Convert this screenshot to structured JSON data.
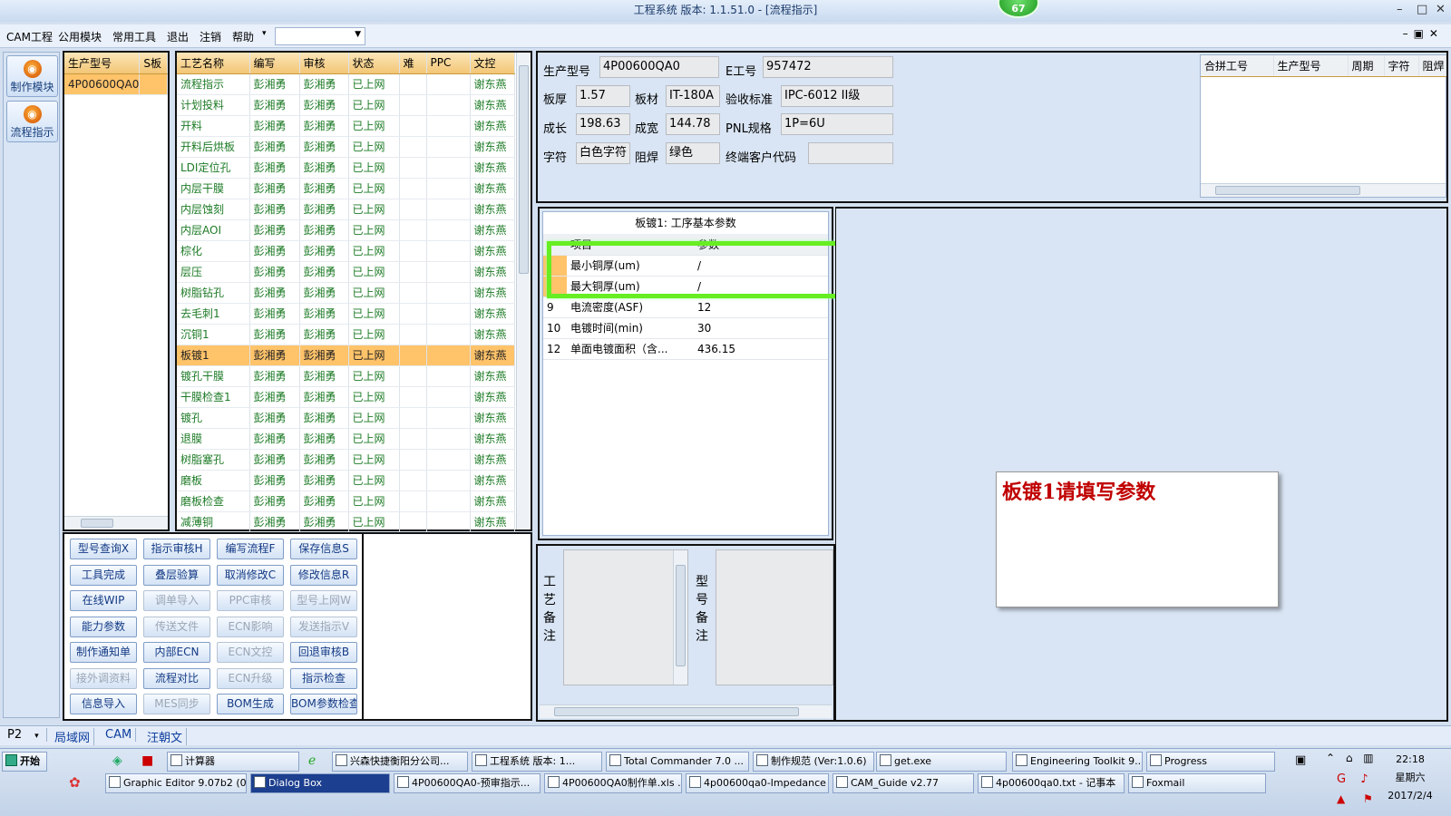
{
  "window": {
    "title": "工程系统   版本: 1.1.51.0 - [流程指示]",
    "badge": "67"
  },
  "menu": [
    "CAM工程",
    "公用模块",
    "常用工具",
    "退出",
    "注销",
    "帮助"
  ],
  "sidebar": [
    {
      "label": "制作模块"
    },
    {
      "label": "流程指示"
    }
  ],
  "models_panel": {
    "columns": [
      "生产型号",
      "S板"
    ],
    "rows": [
      [
        "4P00600QA0",
        ""
      ]
    ]
  },
  "process_table": {
    "columns": [
      "工艺名称",
      "编写",
      "审核",
      "状态",
      "难",
      "PPC",
      "文控"
    ],
    "rows": [
      [
        "流程指示",
        "彭湘勇",
        "彭湘勇",
        "已上网",
        "",
        "",
        "谢东燕"
      ],
      [
        "计划投料",
        "彭湘勇",
        "彭湘勇",
        "已上网",
        "",
        "",
        "谢东燕"
      ],
      [
        "开料",
        "彭湘勇",
        "彭湘勇",
        "已上网",
        "",
        "",
        "谢东燕"
      ],
      [
        "开料后烘板",
        "彭湘勇",
        "彭湘勇",
        "已上网",
        "",
        "",
        "谢东燕"
      ],
      [
        "LDI定位孔",
        "彭湘勇",
        "彭湘勇",
        "已上网",
        "",
        "",
        "谢东燕"
      ],
      [
        "内层干膜",
        "彭湘勇",
        "彭湘勇",
        "已上网",
        "",
        "",
        "谢东燕"
      ],
      [
        "内层蚀刻",
        "彭湘勇",
        "彭湘勇",
        "已上网",
        "",
        "",
        "谢东燕"
      ],
      [
        "内层AOI",
        "彭湘勇",
        "彭湘勇",
        "已上网",
        "",
        "",
        "谢东燕"
      ],
      [
        "棕化",
        "彭湘勇",
        "彭湘勇",
        "已上网",
        "",
        "",
        "谢东燕"
      ],
      [
        "层压",
        "彭湘勇",
        "彭湘勇",
        "已上网",
        "",
        "",
        "谢东燕"
      ],
      [
        "树脂钻孔",
        "彭湘勇",
        "彭湘勇",
        "已上网",
        "",
        "",
        "谢东燕"
      ],
      [
        "去毛刺1",
        "彭湘勇",
        "彭湘勇",
        "已上网",
        "",
        "",
        "谢东燕"
      ],
      [
        "沉铜1",
        "彭湘勇",
        "彭湘勇",
        "已上网",
        "",
        "",
        "谢东燕"
      ],
      [
        "板镀1",
        "彭湘勇",
        "彭湘勇",
        "已上网",
        "",
        "",
        "谢东燕"
      ],
      [
        "镀孔干膜",
        "彭湘勇",
        "彭湘勇",
        "已上网",
        "",
        "",
        "谢东燕"
      ],
      [
        "干膜检查1",
        "彭湘勇",
        "彭湘勇",
        "已上网",
        "",
        "",
        "谢东燕"
      ],
      [
        "镀孔",
        "彭湘勇",
        "彭湘勇",
        "已上网",
        "",
        "",
        "谢东燕"
      ],
      [
        "退膜",
        "彭湘勇",
        "彭湘勇",
        "已上网",
        "",
        "",
        "谢东燕"
      ],
      [
        "树脂塞孔",
        "彭湘勇",
        "彭湘勇",
        "已上网",
        "",
        "",
        "谢东燕"
      ],
      [
        "磨板",
        "彭湘勇",
        "彭湘勇",
        "已上网",
        "",
        "",
        "谢东燕"
      ],
      [
        "磨板检查",
        "彭湘勇",
        "彭湘勇",
        "已上网",
        "",
        "",
        "谢东燕"
      ],
      [
        "减薄铜",
        "彭湘勇",
        "彭湘勇",
        "已上网",
        "",
        "",
        "谢东燕"
      ]
    ],
    "selected_index": 13
  },
  "buttons": [
    {
      "label": "型号查询X",
      "enabled": true
    },
    {
      "label": "指示审核H",
      "enabled": true
    },
    {
      "label": "编写流程F",
      "enabled": true
    },
    {
      "label": "保存信息S",
      "enabled": true
    },
    {
      "label": "工具完成",
      "enabled": true
    },
    {
      "label": "叠层验算",
      "enabled": true
    },
    {
      "label": "取消修改C",
      "enabled": true
    },
    {
      "label": "修改信息R",
      "enabled": true
    },
    {
      "label": "在线WIP",
      "enabled": true
    },
    {
      "label": "调单导入",
      "enabled": false
    },
    {
      "label": "PPC审核",
      "enabled": false
    },
    {
      "label": "型号上网W",
      "enabled": false
    },
    {
      "label": "能力参数",
      "enabled": true
    },
    {
      "label": "传送文件",
      "enabled": false
    },
    {
      "label": "ECN影响",
      "enabled": false
    },
    {
      "label": "发送指示V",
      "enabled": false
    },
    {
      "label": "制作通知单",
      "enabled": true
    },
    {
      "label": "内部ECN",
      "enabled": true
    },
    {
      "label": "ECN文控",
      "enabled": false
    },
    {
      "label": "回退审核B",
      "enabled": true
    },
    {
      "label": "接外调资料",
      "enabled": false
    },
    {
      "label": "流程对比",
      "enabled": true
    },
    {
      "label": "ECN升级",
      "enabled": false
    },
    {
      "label": "指示检查",
      "enabled": true
    },
    {
      "label": "信息导入",
      "enabled": true
    },
    {
      "label": "MES同步",
      "enabled": false
    },
    {
      "label": "BOM生成",
      "enabled": true
    },
    {
      "label": "BOM参数检查",
      "enabled": true
    }
  ],
  "info": {
    "prod_model": {
      "label": "生产型号",
      "value": "4P00600QA0"
    },
    "e_no": {
      "label": "E工号",
      "value": "957472"
    },
    "thickness": {
      "label": "板厚",
      "value": "1.57"
    },
    "material": {
      "label": "板材",
      "value": "IT-180A"
    },
    "standard": {
      "label": "验收标准",
      "value": "IPC-6012 II级"
    },
    "length": {
      "label": "成长",
      "value": "198.63"
    },
    "width": {
      "label": "成宽",
      "value": "144.78"
    },
    "pnl": {
      "label": "PNL规格",
      "value": "1P=6U"
    },
    "legend": {
      "label": "字符",
      "value": "白色字符"
    },
    "mask": {
      "label": "阻焊",
      "value": "绿色"
    },
    "customer": {
      "label": "终端客户代码",
      "value": ""
    }
  },
  "merge_table": {
    "columns": [
      "合拼工号",
      "生产型号",
      "周期",
      "字符",
      "阻焊"
    ]
  },
  "params": {
    "title": "板镀1: 工序基本参数",
    "columns": [
      "",
      "项目",
      "参数"
    ],
    "rows": [
      [
        "",
        "最小铜厚(um)",
        "/"
      ],
      [
        "",
        "最大铜厚(um)",
        "/"
      ],
      [
        "9",
        "电流密度(ASF)",
        "12"
      ],
      [
        "10",
        "电镀时间(min)",
        "30"
      ],
      [
        "12",
        "单面电镀面积（含...",
        "436.15"
      ]
    ]
  },
  "remarks": {
    "process_label": "工艺备注",
    "model_label": "型号备注"
  },
  "callout": {
    "text": "板镀1请填写参数"
  },
  "status_tabs": [
    "P2",
    "局域网",
    "CAM",
    "汪朝文"
  ],
  "taskbar": {
    "start": "开始",
    "row1": [
      "计算器",
      "兴森快捷衡阳分公司...",
      "工程系统   版本: 1...",
      "Total Commander 7.0 ...",
      "制作规范 (Ver:1.0.6)",
      "get.exe",
      "Engineering Toolkit 9....",
      "Progress"
    ],
    "row2": [
      "Graphic Editor 9.07b2 (0...",
      "Dialog Box",
      "4P00600QA0-预审指示...",
      "4P00600QA0制作单.xls ...",
      "4p00600qa0-Impedance ...",
      "CAM_Guide v2.77",
      "4p00600qa0.txt - 记事本",
      "Foxmail"
    ],
    "active_row2": 1,
    "clock": {
      "time": "22:18",
      "weekday": "星期六",
      "date": "2017/2/4"
    }
  },
  "colors": {
    "header_orange": "#f3c676",
    "selected_row": "#ffc36a",
    "green_text": "#1d7b26",
    "highlight": "#66ee22",
    "callout_text": "#c00000"
  }
}
